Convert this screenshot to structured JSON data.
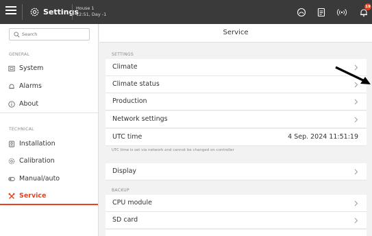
{
  "topbar": {
    "title": "Settings",
    "house_name": "House 1",
    "house_time": "12:51, Day -1",
    "badge_count": "19",
    "icons": [
      "menu-icon",
      "gear-icon",
      "gauge-icon",
      "document-icon",
      "signal-icon",
      "bell-icon"
    ]
  },
  "sidebar": {
    "search_placeholder": "Search",
    "general_label": "GENERAL",
    "technical_label": "TECHNICAL",
    "general_items": [
      {
        "label": "System",
        "icon": "system-icon"
      },
      {
        "label": "Alarms",
        "icon": "alarm-bell-icon"
      },
      {
        "label": "About",
        "icon": "info-icon"
      }
    ],
    "technical_items": [
      {
        "label": "Installation",
        "icon": "installation-icon"
      },
      {
        "label": "Calibration",
        "icon": "calibration-icon"
      },
      {
        "label": "Manual/auto",
        "icon": "toggle-icon"
      },
      {
        "label": "Service",
        "icon": "wrench-icon"
      }
    ],
    "active_item": "Service",
    "accent_color": "#e8421c"
  },
  "main": {
    "title": "Service",
    "settings_label": "SETTINGS",
    "settings_rows": [
      {
        "label": "Climate"
      },
      {
        "label": "Climate status"
      },
      {
        "label": "Production"
      },
      {
        "label": "Network settings"
      }
    ],
    "utc": {
      "label": "UTC time",
      "value": "4 Sep. 2024 11:51:19"
    },
    "utc_note": "UTC time is set via network and cannot be changed on controller",
    "display": {
      "label": "Display"
    },
    "backup_label": "BACKUP",
    "backup_rows": [
      {
        "label": "CPU module"
      },
      {
        "label": "SD card"
      }
    ]
  }
}
